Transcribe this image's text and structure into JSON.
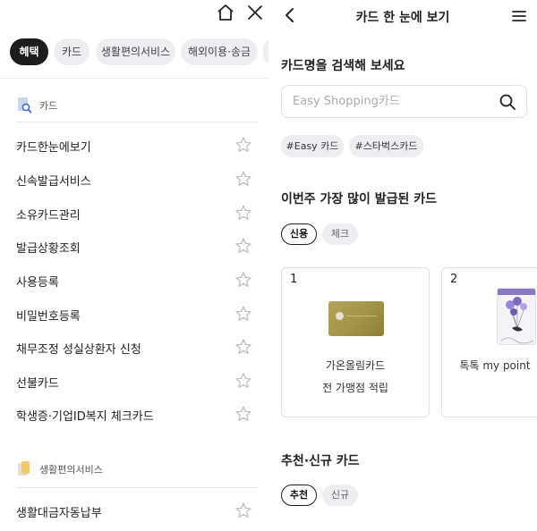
{
  "left": {
    "chips": [
      {
        "label": "혜택",
        "active": true
      },
      {
        "label": "카드",
        "active": false
      },
      {
        "label": "생활편의서비스",
        "active": false
      },
      {
        "label": "해외이용·송금",
        "active": false
      }
    ],
    "sections": [
      {
        "title": "카드",
        "icon": "card-search-icon",
        "items": [
          "카드한눈에보기",
          "신속발급서비스",
          "소유카드관리",
          "발급상황조회",
          "사용등록",
          "비밀번호등록",
          "채무조정 성실상환자 신청",
          "선불카드",
          "학생증·기업ID복지 체크카드"
        ]
      },
      {
        "title": "생활편의서비스",
        "icon": "life-service-icon",
        "items": [
          "생활대금자동납부"
        ]
      }
    ]
  },
  "right": {
    "header": {
      "title": "카드 한 눈에 보기"
    },
    "search": {
      "title": "카드명을 검색해 보세요",
      "placeholder": "Easy Shopping카드"
    },
    "tags": [
      "#Easy 카드",
      "#스타벅스카드"
    ],
    "popular": {
      "title": "이번주 가장 많이 발급된 카드",
      "toggle": [
        {
          "label": "신용",
          "selected": true
        },
        {
          "label": "체크",
          "selected": false
        }
      ],
      "cards": [
        {
          "rank": "1",
          "name": "가온올림카드",
          "desc": "전 가맹점 적립"
        },
        {
          "rank": "2",
          "name": "톡톡 my point",
          "desc": ""
        }
      ]
    },
    "recommend": {
      "title": "추천·신규 카드",
      "toggle": [
        {
          "label": "추천",
          "selected": true
        },
        {
          "label": "신규",
          "selected": false
        }
      ]
    }
  },
  "colors": {
    "active_chip": "#1d1d1f",
    "chip_bg": "#eceef1",
    "border": "#dfe1e5",
    "gold_card": "#a89a4e",
    "text": "#222222"
  }
}
